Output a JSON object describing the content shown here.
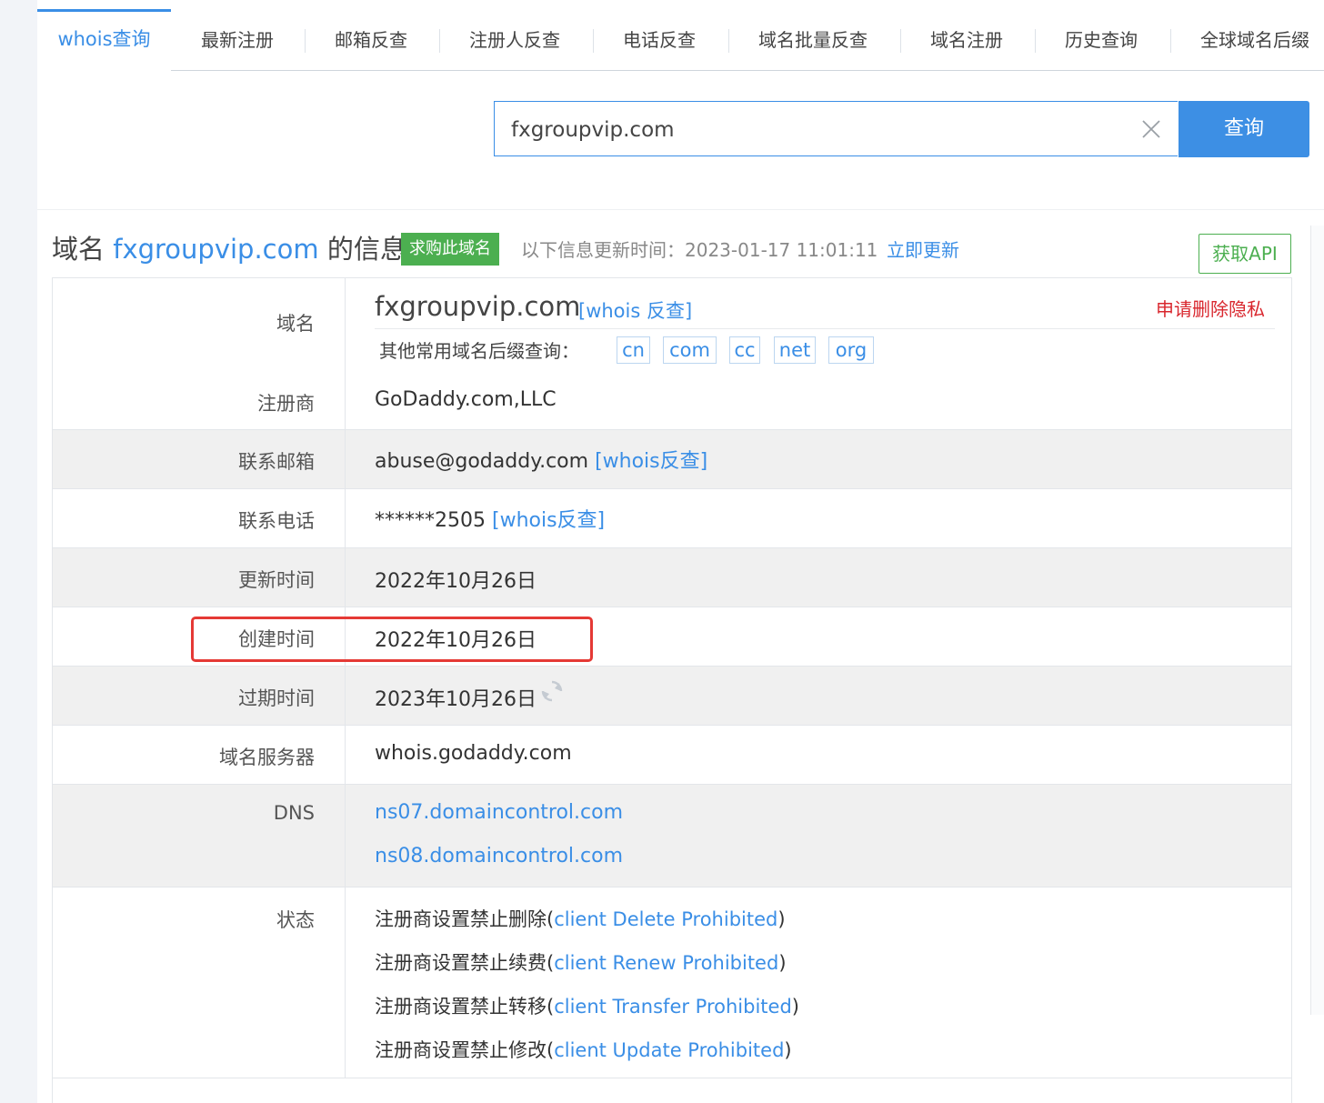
{
  "tabs": {
    "active": "whois查询",
    "items": [
      "最新注册",
      "邮箱反查",
      "注册人反查",
      "电话反查",
      "域名批量反查",
      "域名注册",
      "历史查询",
      "全球域名后缀"
    ]
  },
  "search": {
    "value": "fxgroupvip.com",
    "button": "查询"
  },
  "heading": {
    "prefix": "域名",
    "domain": "fxgroupvip.com",
    "suffix": "的信息",
    "buy_badge": "求购此域名",
    "update_text": "以下信息更新时间：2023-01-17 11:01:11",
    "update_link": "立即更新",
    "api_button": "获取API"
  },
  "rows": {
    "domain": {
      "label": "域名",
      "value": "fxgroupvip.com",
      "whois_link": "[whois 反查]",
      "privacy_link": "申请删除隐私",
      "suffix_label": "其他常用域名后缀查询：",
      "suffixes": [
        "cn",
        "com",
        "cc",
        "net",
        "org"
      ]
    },
    "registrar": {
      "label": "注册商",
      "value": "GoDaddy.com,LLC"
    },
    "email": {
      "label": "联系邮箱",
      "value": "abuse@godaddy.com",
      "link": "[whois反查]"
    },
    "phone": {
      "label": "联系电话",
      "value": "******2505",
      "link": "[whois反查]"
    },
    "updated": {
      "label": "更新时间",
      "value": "2022年10月26日"
    },
    "created": {
      "label": "创建时间",
      "value": "2022年10月26日"
    },
    "expires": {
      "label": "过期时间",
      "value": "2023年10月26日"
    },
    "whois_server": {
      "label": "域名服务器",
      "value": "whois.godaddy.com"
    },
    "dns": {
      "label": "DNS",
      "values": [
        "ns07.domaincontrol.com",
        "ns08.domaincontrol.com"
      ]
    },
    "status": {
      "label": "状态",
      "items": [
        {
          "cn": "注册商设置禁止删除(",
          "en": "client Delete Prohibited",
          "end": ")"
        },
        {
          "cn": "注册商设置禁止续费(",
          "en": "client Renew Prohibited",
          "end": ")"
        },
        {
          "cn": "注册商设置禁止转移(",
          "en": "client Transfer Prohibited",
          "end": ")"
        },
        {
          "cn": "注册商设置禁止修改(",
          "en": "client Update Prohibited",
          "end": ")"
        }
      ]
    }
  },
  "colors": {
    "accent": "#3a8ee6",
    "buy_green": "#4caf50",
    "privacy_red": "#d9272e",
    "highlight_red": "#e53935"
  },
  "icons": {
    "clear": "close-icon",
    "refresh": "refresh-icon"
  }
}
